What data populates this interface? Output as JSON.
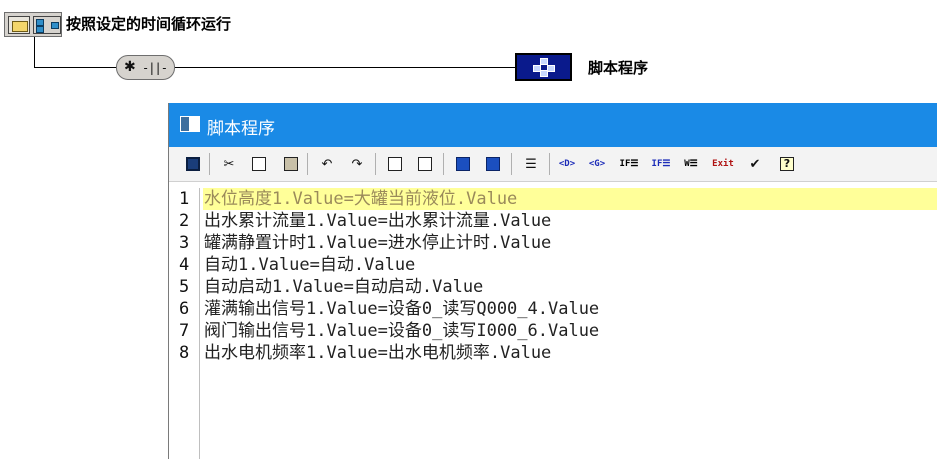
{
  "flowchart": {
    "top_node_title": "按照设定的时间循环运行",
    "script_node_label": "脚本程序"
  },
  "window": {
    "title": "脚本程序",
    "toolbar": [
      {
        "name": "save-icon",
        "glyph": "💾"
      },
      {
        "name": "cut-icon",
        "glyph": "✂"
      },
      {
        "name": "copy-icon",
        "glyph": "⧉"
      },
      {
        "name": "paste-icon",
        "glyph": "📋"
      },
      {
        "name": "undo-icon",
        "glyph": "↶"
      },
      {
        "name": "redo-icon",
        "glyph": "↷"
      },
      {
        "name": "find-icon",
        "glyph": "🔍"
      },
      {
        "name": "replace-icon",
        "glyph": "⇄"
      },
      {
        "name": "indent-icon",
        "glyph": "⇥"
      },
      {
        "name": "outdent-icon",
        "glyph": "⇤"
      },
      {
        "name": "comment-icon",
        "glyph": "☰"
      },
      {
        "name": "insert-d-icon",
        "glyph": "<D>"
      },
      {
        "name": "insert-g-icon",
        "glyph": "<G>"
      },
      {
        "name": "if-then-icon",
        "glyph": "IF"
      },
      {
        "name": "if-else-icon",
        "glyph": "IF"
      },
      {
        "name": "while-icon",
        "glyph": "W"
      },
      {
        "name": "exit-icon",
        "glyph": "Exit"
      },
      {
        "name": "check-icon",
        "glyph": "✔"
      },
      {
        "name": "help-icon",
        "glyph": "?"
      }
    ]
  },
  "editor": {
    "lines": [
      {
        "num": "1",
        "code": "水位高度1.Value=大罐当前液位.Value"
      },
      {
        "num": "2",
        "code": "出水累计流量1.Value=出水累计流量.Value"
      },
      {
        "num": "3",
        "code": "罐满静置计时1.Value=进水停止计时.Value"
      },
      {
        "num": "4",
        "code": "自动1.Value=自动.Value"
      },
      {
        "num": "5",
        "code": "自动启动1.Value=自动启动.Value"
      },
      {
        "num": "6",
        "code": "灌满输出信号1.Value=设备0_读写Q000_4.Value"
      },
      {
        "num": "7",
        "code": "阀门输出信号1.Value=设备0_读写I000_6.Value"
      },
      {
        "num": "8",
        "code": "出水电机频率1.Value=出水电机频率.Value"
      }
    ]
  },
  "colors": {
    "titlebar": "#1a8ae6",
    "active_line": "#ffff99",
    "script_node": "#0a1a8c"
  }
}
